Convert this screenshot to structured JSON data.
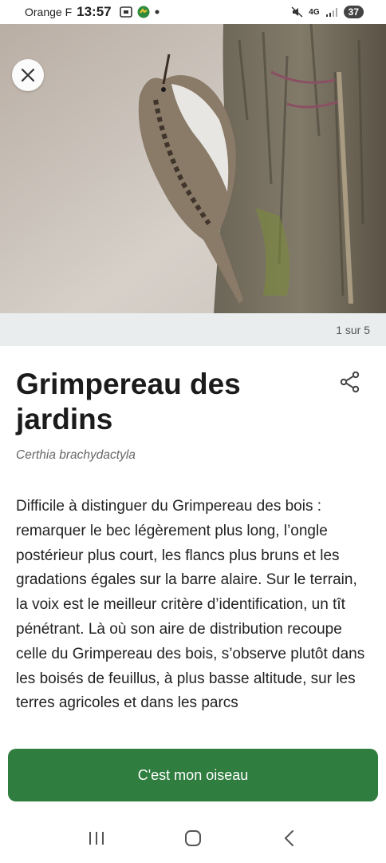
{
  "status_bar": {
    "carrier": "Orange F",
    "time": "13:57",
    "network": "4G",
    "battery": "37"
  },
  "photo": {
    "counter": "1 sur 5"
  },
  "bird": {
    "name": "Grimpereau des jardins",
    "scientific_name": "Certhia brachydactyla",
    "description": "Difficile à distinguer du Grimpereau des bois : remarquer le bec légèrement plus long, l’ongle postérieur plus court, les flancs plus bruns et les gradations égales sur la barre alaire. Sur le terrain, la voix est le meilleur critère d’identification, un tît pénétrant. Là où son aire de distribution recoupe celle du Grimpereau des bois, s’observe plutôt dans les boisés de feuillus, à plus basse altitude, sur les terres agricoles et dans les parcs"
  },
  "actions": {
    "confirm_label": "C'est mon oiseau"
  },
  "icons": {
    "close": "close-icon",
    "share": "share-icon",
    "nav_recent": "recent-apps-icon",
    "nav_home": "home-icon",
    "nav_back": "back-icon"
  },
  "colors": {
    "primary": "#2f7d3f",
    "strip": "#e9eded"
  }
}
